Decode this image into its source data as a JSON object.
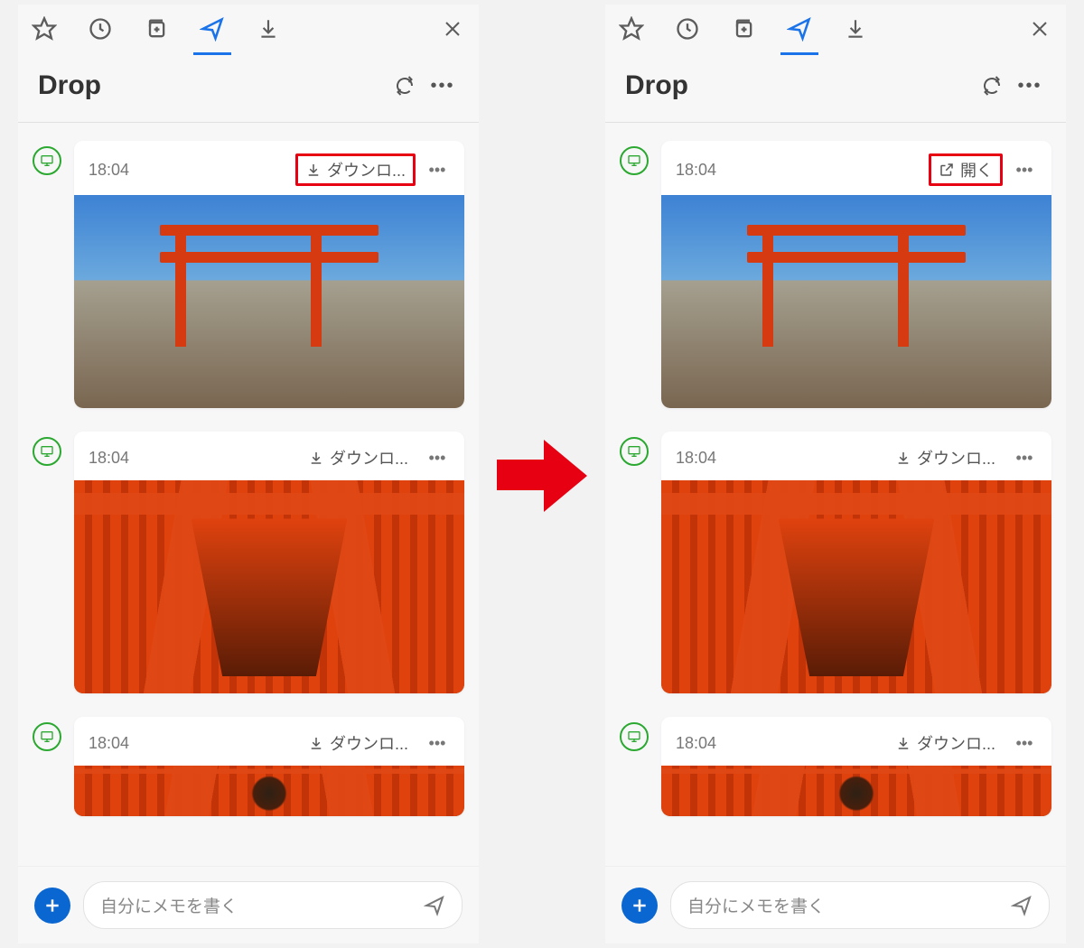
{
  "panels": [
    {
      "title": "Drop",
      "compose_placeholder": "自分にメモを書く",
      "items": [
        {
          "time": "18:04",
          "action_label": "ダウンロ...",
          "action_icon": "download",
          "highlight": true,
          "image": "shrine"
        },
        {
          "time": "18:04",
          "action_label": "ダウンロ...",
          "action_icon": "download",
          "highlight": false,
          "image": "tunnel"
        },
        {
          "time": "18:04",
          "action_label": "ダウンロ...",
          "action_icon": "download",
          "highlight": false,
          "image": "tunnel",
          "peek": true
        }
      ]
    },
    {
      "title": "Drop",
      "compose_placeholder": "自分にメモを書く",
      "items": [
        {
          "time": "18:04",
          "action_label": "開く",
          "action_icon": "open",
          "highlight": true,
          "image": "shrine"
        },
        {
          "time": "18:04",
          "action_label": "ダウンロ...",
          "action_icon": "download",
          "highlight": false,
          "image": "tunnel"
        },
        {
          "time": "18:04",
          "action_label": "ダウンロ...",
          "action_icon": "download",
          "highlight": false,
          "image": "tunnel",
          "peek": true
        }
      ]
    }
  ]
}
